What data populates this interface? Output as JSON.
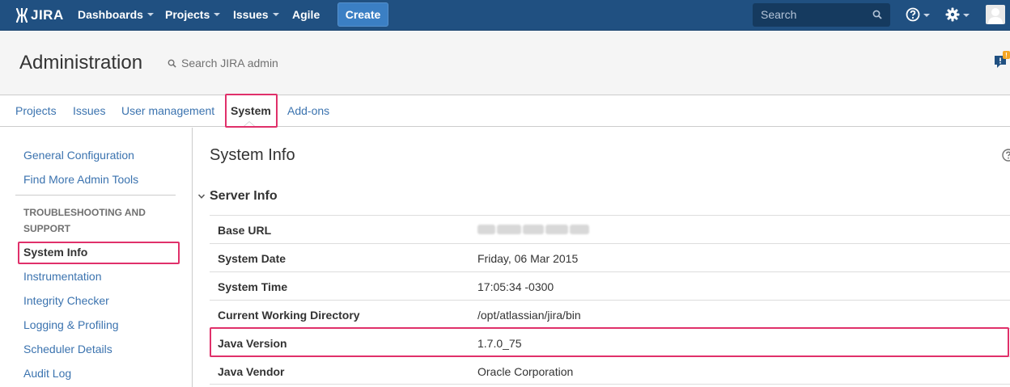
{
  "topnav": {
    "logo_text": "JIRA",
    "items": [
      {
        "label": "Dashboards",
        "has_caret": true
      },
      {
        "label": "Projects",
        "has_caret": true
      },
      {
        "label": "Issues",
        "has_caret": true
      },
      {
        "label": "Agile",
        "has_caret": false
      }
    ],
    "create_label": "Create",
    "search_placeholder": "Search",
    "icons": [
      "help-icon",
      "gear-icon",
      "avatar"
    ],
    "colors": {
      "bar": "#205081",
      "create": "#3b7fc4"
    }
  },
  "admin": {
    "title": "Administration",
    "search_label": "Search JIRA admin",
    "feedback_badge": "!"
  },
  "tabs": [
    {
      "label": "Projects",
      "active": false
    },
    {
      "label": "Issues",
      "active": false
    },
    {
      "label": "User management",
      "active": false
    },
    {
      "label": "System",
      "active": true
    },
    {
      "label": "Add-ons",
      "active": false
    }
  ],
  "sidebar": {
    "top_links": [
      "General Configuration",
      "Find More Admin Tools"
    ],
    "section_heading": "TROUBLESHOOTING AND SUPPORT",
    "section_links": [
      {
        "label": "System Info",
        "active": true
      },
      {
        "label": "Instrumentation",
        "active": false
      },
      {
        "label": "Integrity Checker",
        "active": false
      },
      {
        "label": "Logging & Profiling",
        "active": false
      },
      {
        "label": "Scheduler Details",
        "active": false
      },
      {
        "label": "Audit Log",
        "active": false
      }
    ]
  },
  "main": {
    "title": "System Info",
    "section_title": "Server Info",
    "rows": [
      {
        "key": "Base URL",
        "value": ""
      },
      {
        "key": "System Date",
        "value": "Friday, 06 Mar 2015"
      },
      {
        "key": "System Time",
        "value": "17:05:34 -0300"
      },
      {
        "key": "Current Working Directory",
        "value": "/opt/atlassian/jira/bin"
      },
      {
        "key": "Java Version",
        "value": "1.7.0_75"
      },
      {
        "key": "Java Vendor",
        "value": "Oracle Corporation"
      }
    ]
  },
  "highlight_color": "#e0306a"
}
